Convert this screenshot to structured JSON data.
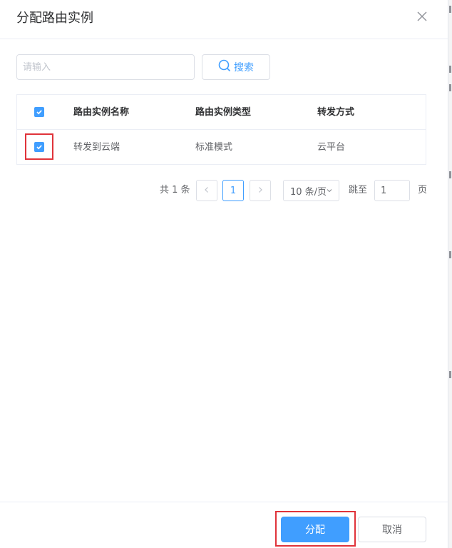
{
  "dialog": {
    "title": "分配路由实例",
    "close_icon": "close-icon"
  },
  "search": {
    "placeholder": "请输入",
    "value": "",
    "button_label": "搜索",
    "button_icon": "search-icon"
  },
  "table": {
    "columns": [
      "路由实例名称",
      "路由实例类型",
      "转发方式"
    ],
    "header_checked": true,
    "rows": [
      {
        "checked": true,
        "cells": [
          "转发到云端",
          "标准模式",
          "云平台"
        ]
      }
    ]
  },
  "pagination": {
    "total_label": "共 1 条",
    "prev_icon": "chevron-left-icon",
    "current_page": "1",
    "next_icon": "chevron-right-icon",
    "page_size": "10 条/页",
    "jump_label": "跳至",
    "jump_value": "1",
    "page_suffix": "页"
  },
  "footer": {
    "assign_label": "分配",
    "cancel_label": "取消"
  },
  "colors": {
    "primary": "#409eff",
    "highlight": "#e0333a"
  }
}
